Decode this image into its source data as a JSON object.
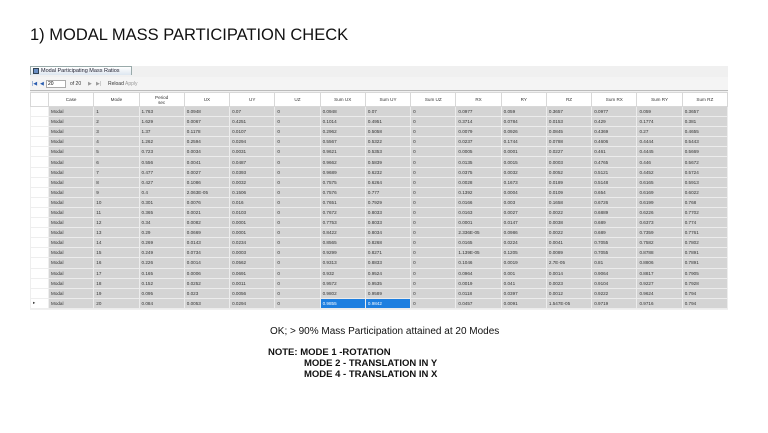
{
  "title": "1) MODAL MASS PARTICIPATION CHECK",
  "window": {
    "tab_label": "Modal Participating Mass Ratios",
    "toolbar": {
      "first": "|◀",
      "prev": "◀",
      "record": "20",
      "of_label": "of 20",
      "next": "▶",
      "last": "▶|",
      "reload": "Reload",
      "apply": "Apply"
    }
  },
  "columns": [
    "Case",
    "Mode",
    "Period\nsec",
    "UX",
    "UY",
    "UZ",
    "Sum UX",
    "Sum UY",
    "Sum UZ",
    "RX",
    "RY",
    "RZ",
    "Sum RX",
    "Sum RY",
    "Sum RZ"
  ],
  "rows": [
    [
      "Modal",
      "1",
      "1.763",
      "0.0948",
      "0.07",
      "0",
      "0.0948",
      "0.07",
      "0",
      "0.0977",
      "0.059",
      "0.3657",
      "0.0977",
      "0.059",
      "0.3657"
    ],
    [
      "Modal",
      "2",
      "1.629",
      "0.0067",
      "0.4251",
      "0",
      "0.1014",
      "0.4951",
      "0",
      "0.3714",
      "0.0784",
      "0.0153",
      "0.429",
      "0.1774",
      "0.381"
    ],
    [
      "Modal",
      "3",
      "1.37",
      "0.1178",
      "0.0107",
      "0",
      "0.2962",
      "0.5058",
      "0",
      "0.0079",
      "0.0926",
      "0.0845",
      "0.4369",
      "0.27",
      "0.4655"
    ],
    [
      "Modal",
      "4",
      "1.262",
      "0.2594",
      "0.0294",
      "0",
      "0.5567",
      "0.5322",
      "0",
      "0.0237",
      "0.1744",
      "0.0788",
      "0.4606",
      "0.4444",
      "0.5443"
    ],
    [
      "Modal",
      "5",
      "0.723",
      "0.0034",
      "0.0031",
      "0",
      "0.9621",
      "0.5353",
      "0",
      "0.0005",
      "0.0001",
      "0.0227",
      "0.461",
      "0.4445",
      "0.5669"
    ],
    [
      "Modal",
      "6",
      "0.556",
      "0.0041",
      "0.0487",
      "0",
      "0.9662",
      "0.5839",
      "0",
      "0.0135",
      "0.0015",
      "0.0003",
      "0.4765",
      "0.446",
      "0.5672"
    ],
    [
      "Modal",
      "7",
      "0.477",
      "0.0027",
      "0.0393",
      "0",
      "0.9689",
      "0.6232",
      "0",
      "0.0375",
      "0.0032",
      "0.0052",
      "0.5121",
      "0.4452",
      "0.5724"
    ],
    [
      "Modal",
      "8",
      "0.427",
      "0.1086",
      "0.0032",
      "0",
      "0.7575",
      "0.6264",
      "0",
      "0.0028",
      "0.1673",
      "0.0189",
      "0.5148",
      "0.6165",
      "0.5913"
    ],
    [
      "Modal",
      "9",
      "0.4",
      "2.063E-05",
      "0.1506",
      "0",
      "0.7576",
      "0.777",
      "0",
      "0.1392",
      "0.0004",
      "0.0109",
      "0.654",
      "0.6169",
      "0.6022"
    ],
    [
      "Modal",
      "10",
      "0.301",
      "0.0076",
      "0.016",
      "0",
      "0.7651",
      "0.7929",
      "0",
      "0.0166",
      "0.003",
      "0.1658",
      "0.6726",
      "0.6199",
      "0.768"
    ],
    [
      "Modal",
      "11",
      "0.365",
      "0.0021",
      "0.0103",
      "0",
      "0.7672",
      "0.8033",
      "0",
      "0.0163",
      "0.0027",
      "0.0022",
      "0.6889",
      "0.6226",
      "0.7702"
    ],
    [
      "Modal",
      "12",
      "0.34",
      "0.0082",
      "0.0001",
      "0",
      "0.7753",
      "0.8033",
      "0",
      "0.0001",
      "0.0147",
      "0.0038",
      "0.689",
      "0.6373",
      "0.774"
    ],
    [
      "Modal",
      "13",
      "0.29",
      "0.0669",
      "0.0001",
      "0",
      "0.8422",
      "0.8034",
      "0",
      "2.336E-05",
      "0.0986",
      "0.0022",
      "0.689",
      "0.7359",
      "0.7761"
    ],
    [
      "Modal",
      "14",
      "0.269",
      "0.0143",
      "0.0234",
      "0",
      "0.8565",
      "0.8268",
      "0",
      "0.0165",
      "0.0224",
      "0.0041",
      "0.7055",
      "0.7582",
      "0.7802"
    ],
    [
      "Modal",
      "15",
      "0.249",
      "0.0734",
      "0.0003",
      "0",
      "0.9299",
      "0.8271",
      "0",
      "1.139E-05",
      "0.1205",
      "0.0089",
      "0.7055",
      "0.8788",
      "0.7891"
    ],
    [
      "Modal",
      "16",
      "0.226",
      "0.0014",
      "0.0562",
      "0",
      "0.9313",
      "0.8833",
      "0",
      "0.1046",
      "0.0019",
      "2.7E-05",
      "0.81",
      "0.8806",
      "0.7891"
    ],
    [
      "Modal",
      "17",
      "0.165",
      "0.0006",
      "0.0691",
      "0",
      "0.932",
      "0.9524",
      "0",
      "0.0964",
      "0.001",
      "0.0014",
      "0.9064",
      "0.8817",
      "0.7905"
    ],
    [
      "Modal",
      "18",
      "0.152",
      "0.0252",
      "0.0011",
      "0",
      "0.9572",
      "0.9535",
      "0",
      "0.0019",
      "0.041",
      "0.0023",
      "0.9104",
      "0.9227",
      "0.7928"
    ],
    [
      "Modal",
      "19",
      "0.095",
      "0.023",
      "0.0056",
      "0",
      "0.9802",
      "0.9589",
      "0",
      "0.0118",
      "0.0397",
      "0.0012",
      "0.9222",
      "0.9624",
      "0.794"
    ],
    [
      "Modal",
      "20",
      "0.084",
      "0.0053",
      "0.0294",
      "0",
      "0.9855",
      "0.9842",
      "0",
      "0.0457",
      "0.0091",
      "1.547E-05",
      "0.9719",
      "0.9716",
      "0.794"
    ]
  ],
  "conclusion": "OK; > 90% Mass Participation attained at 20 Modes",
  "note": {
    "label": "NOTE:",
    "lines": [
      "MODE 1 -ROTATION",
      "MODE 2 - TRANSLATION IN Y",
      "MODE 4 - TRANSLATION IN X"
    ]
  }
}
